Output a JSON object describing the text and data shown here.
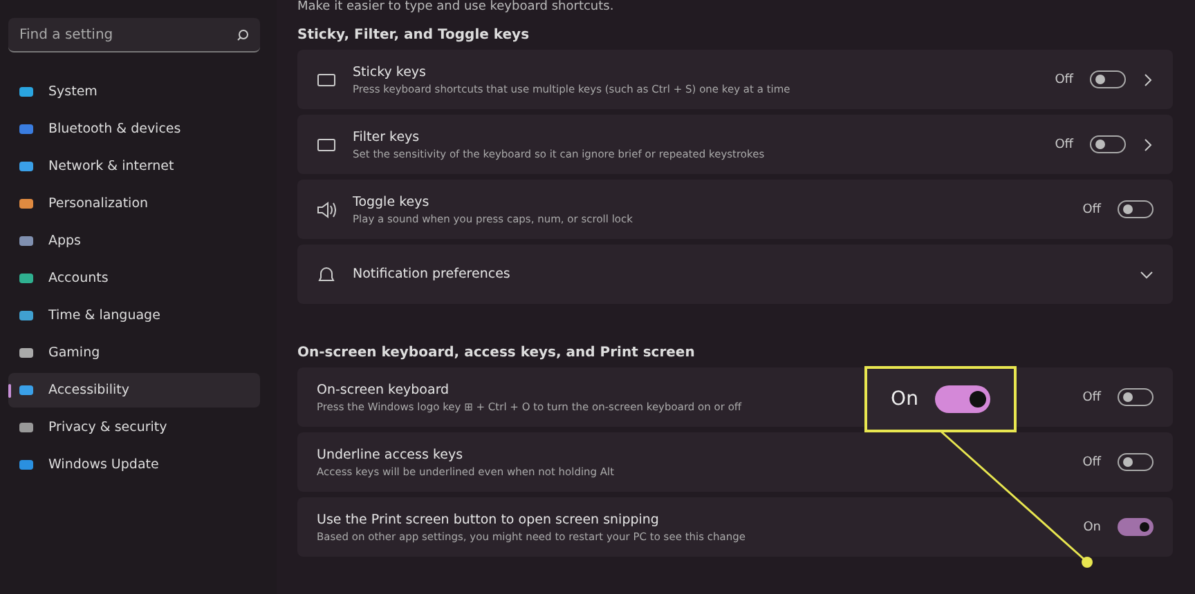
{
  "search": {
    "placeholder": "Find a setting"
  },
  "sidebar": {
    "items": [
      {
        "label": "System",
        "selected": false
      },
      {
        "label": "Bluetooth & devices",
        "selected": false
      },
      {
        "label": "Network & internet",
        "selected": false
      },
      {
        "label": "Personalization",
        "selected": false
      },
      {
        "label": "Apps",
        "selected": false
      },
      {
        "label": "Accounts",
        "selected": false
      },
      {
        "label": "Time & language",
        "selected": false
      },
      {
        "label": "Gaming",
        "selected": false
      },
      {
        "label": "Accessibility",
        "selected": true
      },
      {
        "label": "Privacy & security",
        "selected": false
      },
      {
        "label": "Windows Update",
        "selected": false
      }
    ]
  },
  "intro": "Make it easier to type and use keyboard shortcuts.",
  "sections": [
    {
      "title": "Sticky, Filter, and Toggle keys",
      "rows": [
        {
          "kind": "toggle",
          "title": "Sticky keys",
          "description": "Press keyboard shortcuts that use multiple keys (such as Ctrl + S) one key at a time",
          "state": "Off",
          "on": false,
          "chevron": true
        },
        {
          "kind": "toggle",
          "title": "Filter keys",
          "description": "Set the sensitivity of the keyboard so it can ignore brief or repeated keystrokes",
          "state": "Off",
          "on": false,
          "chevron": true
        },
        {
          "kind": "toggle",
          "title": "Toggle keys",
          "description": "Play a sound when you press caps, num, or scroll lock",
          "state": "Off",
          "on": false,
          "chevron": false
        },
        {
          "kind": "expander",
          "title": "Notification preferences",
          "expanded": false
        }
      ]
    },
    {
      "title": "On-screen keyboard, access keys, and Print screen",
      "rows": [
        {
          "kind": "toggle",
          "title": "On-screen keyboard",
          "description": "Press the Windows logo key ⊞ + Ctrl + O to turn the on-screen keyboard on or off",
          "state": "Off",
          "on": false,
          "chevron": false
        },
        {
          "kind": "toggle",
          "title": "Underline access keys",
          "description": "Access keys will be underlined even when not holding Alt",
          "state": "Off",
          "on": false,
          "chevron": false
        },
        {
          "kind": "toggle",
          "title": "Use the Print screen button to open screen snipping",
          "description": "Based on other app settings, you might need to restart your PC to see this change",
          "state": "On",
          "on": true,
          "chevron": false
        }
      ]
    }
  ],
  "callout": {
    "label": "On",
    "on": true
  }
}
